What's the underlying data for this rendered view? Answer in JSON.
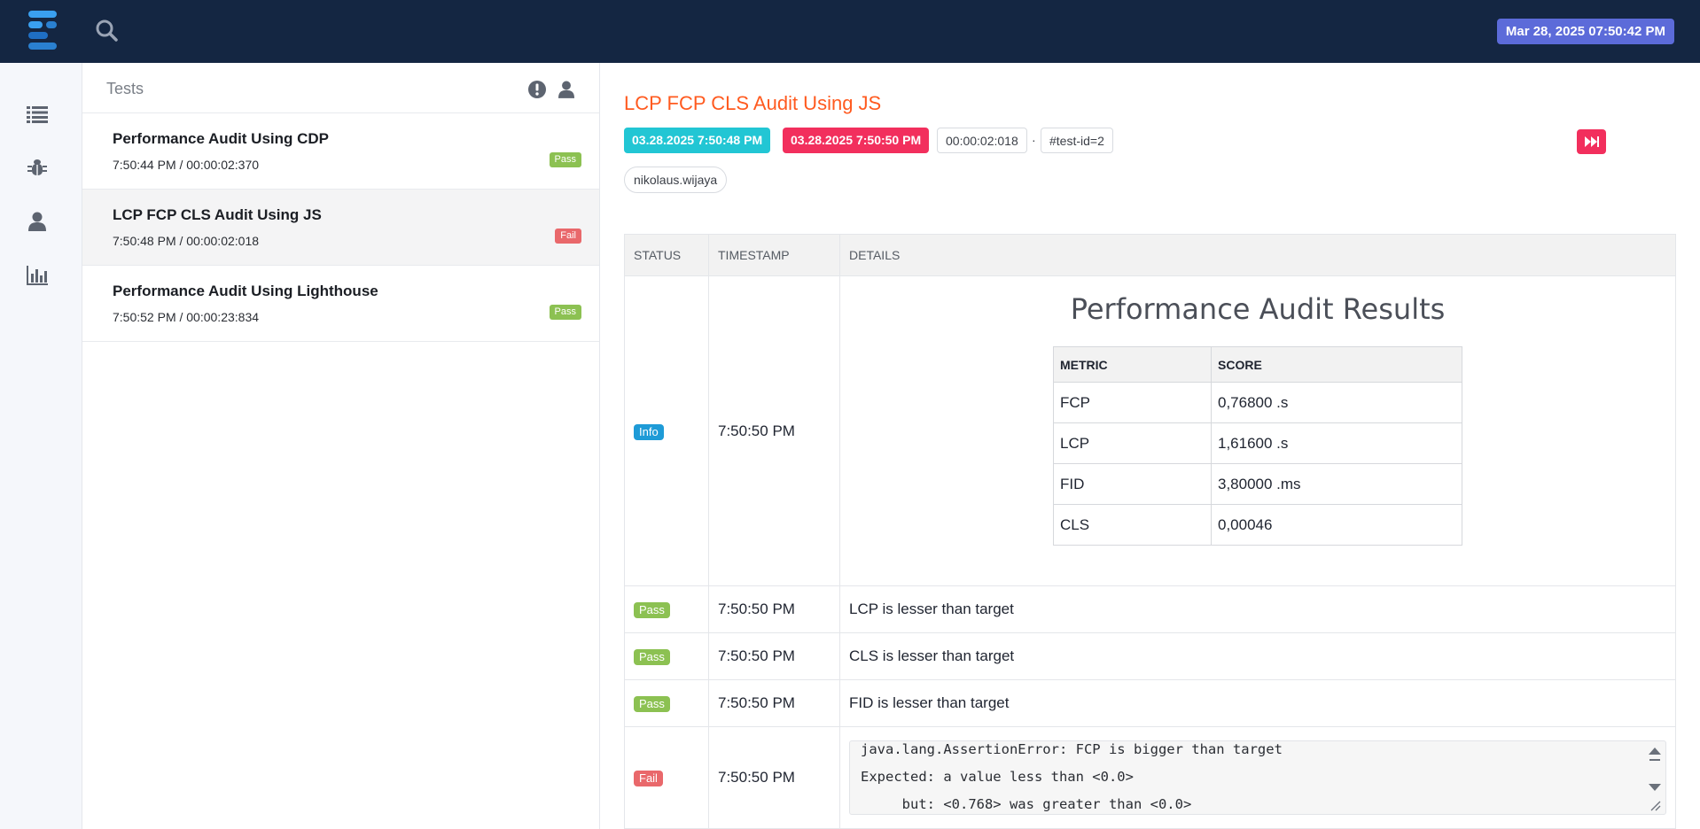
{
  "header": {
    "datetime": "Mar 28, 2025 07:50:42 PM"
  },
  "nav": {
    "items": [
      "tests-list",
      "bugs",
      "authors",
      "dashboard"
    ]
  },
  "test_list": {
    "title": "Tests",
    "items": [
      {
        "name": "Performance Audit Using CDP",
        "meta": "7:50:44 PM / 00:00:02:370",
        "status": "Pass"
      },
      {
        "name": "LCP FCP CLS Audit Using JS",
        "meta": "7:50:48 PM / 00:00:02:018",
        "status": "Fail"
      },
      {
        "name": "Performance Audit Using Lighthouse",
        "meta": "7:50:52 PM / 00:00:23:834",
        "status": "Pass"
      }
    ]
  },
  "detail": {
    "title": "LCP FCP CLS Audit Using JS",
    "start": "03.28.2025 7:50:48 PM",
    "end": "03.28.2025 7:50:50 PM",
    "duration": "00:00:02:018",
    "separator": "·",
    "test_id": "#test-id=2",
    "author": "nikolaus.wijaya"
  },
  "log": {
    "headers": [
      "STATUS",
      "TIMESTAMP",
      "DETAILS"
    ],
    "audit": {
      "title": "Performance Audit Results",
      "headers": [
        "METRIC",
        "SCORE"
      ],
      "rows": [
        [
          "FCP",
          "0,76800 .s"
        ],
        [
          "LCP",
          "1,61600 .s"
        ],
        [
          "FID",
          "3,80000 .ms"
        ],
        [
          "CLS",
          "0,00046"
        ]
      ]
    },
    "rows": [
      {
        "status": "Info",
        "time": "7:50:50 PM"
      },
      {
        "status": "Pass",
        "time": "7:50:50 PM",
        "detail": "LCP is lesser than target"
      },
      {
        "status": "Pass",
        "time": "7:50:50 PM",
        "detail": "CLS is lesser than target"
      },
      {
        "status": "Pass",
        "time": "7:50:50 PM",
        "detail": "FID is lesser than target"
      },
      {
        "status": "Fail",
        "time": "7:50:50 PM",
        "code": "java.lang.AssertionError: FCP is bigger than target\nExpected: a value less than <0.0>\n     but: <0.768> was greater than <0.0>"
      }
    ]
  },
  "colors": {
    "topbar": "#142642",
    "date_badge": "#5c6bd9",
    "title_orange": "#ff5a1f",
    "start_chip": "#22c6d4",
    "end_chip": "#f22f5d",
    "pass": "#8cc152",
    "fail": "#e9686b",
    "info": "#1e9bd7"
  }
}
